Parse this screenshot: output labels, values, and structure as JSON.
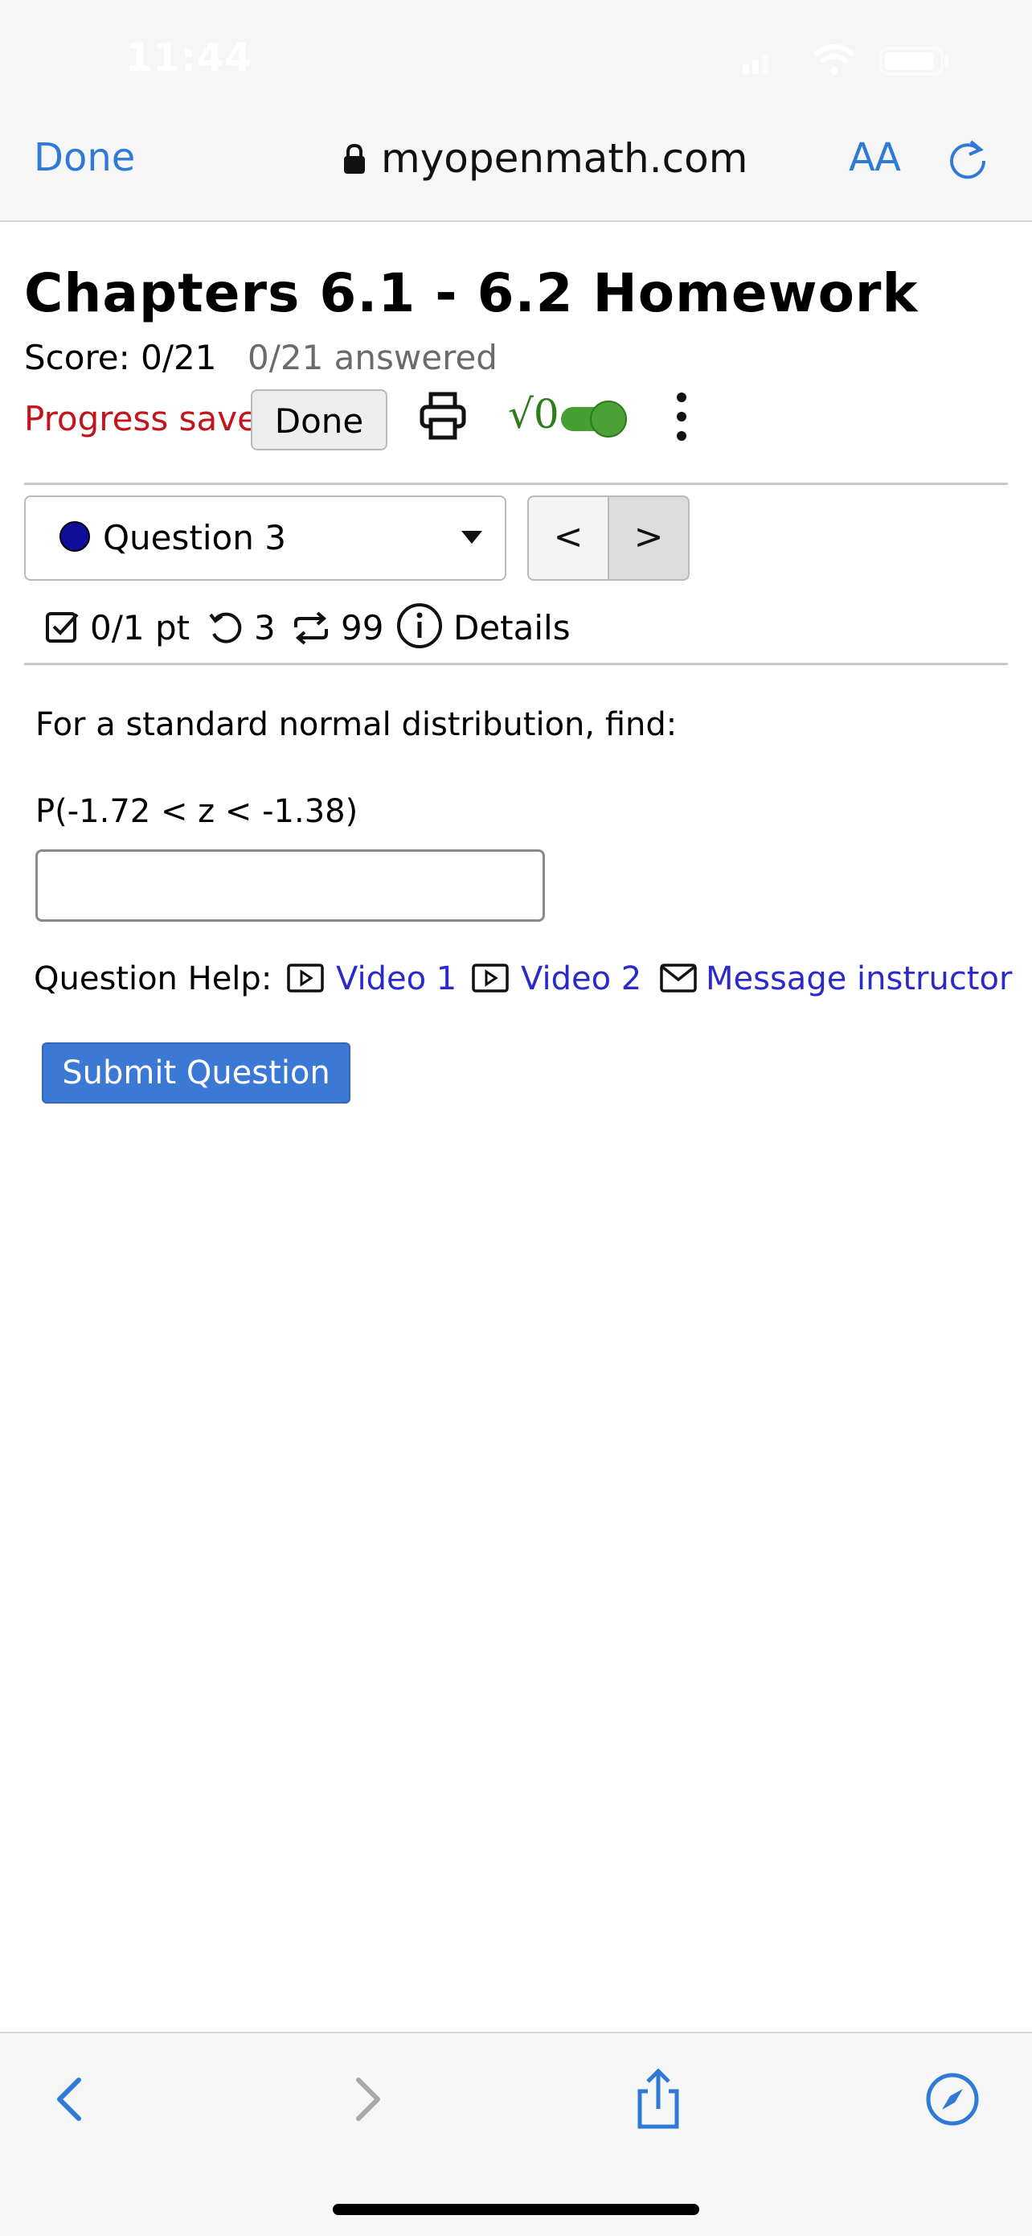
{
  "status_bar": {
    "time": "11:44"
  },
  "browser": {
    "done_label": "Done",
    "url": "myopenmath.com",
    "text_size_label": "AA"
  },
  "page": {
    "title": "Chapters 6.1 - 6.2 Homework",
    "score": "Score: 0/21",
    "answered": "0/21 answered",
    "progress": "Progress saved",
    "done_button": "Done",
    "sqrt_label": "√0"
  },
  "question_nav": {
    "selected": "Question 3",
    "prev_glyph": "<",
    "next_glyph": ">"
  },
  "info": {
    "points": "0/1 pt",
    "retries": "3",
    "attempts": "99",
    "details": "Details"
  },
  "question": {
    "prompt": "For a standard normal distribution, find:",
    "expression": "P(-1.72 < z < -1.38)",
    "answer_value": ""
  },
  "help": {
    "label": "Question Help:",
    "video1": "Video 1",
    "video2": "Video 2",
    "message": "Message instructor"
  },
  "submit_label": "Submit Question",
  "colors": {
    "accent_blue": "#2f7ad6",
    "link_blue": "#2a2acc",
    "progress_red": "#c4141b",
    "submit_blue": "#3b79d5",
    "toggle_green": "#46a031"
  }
}
